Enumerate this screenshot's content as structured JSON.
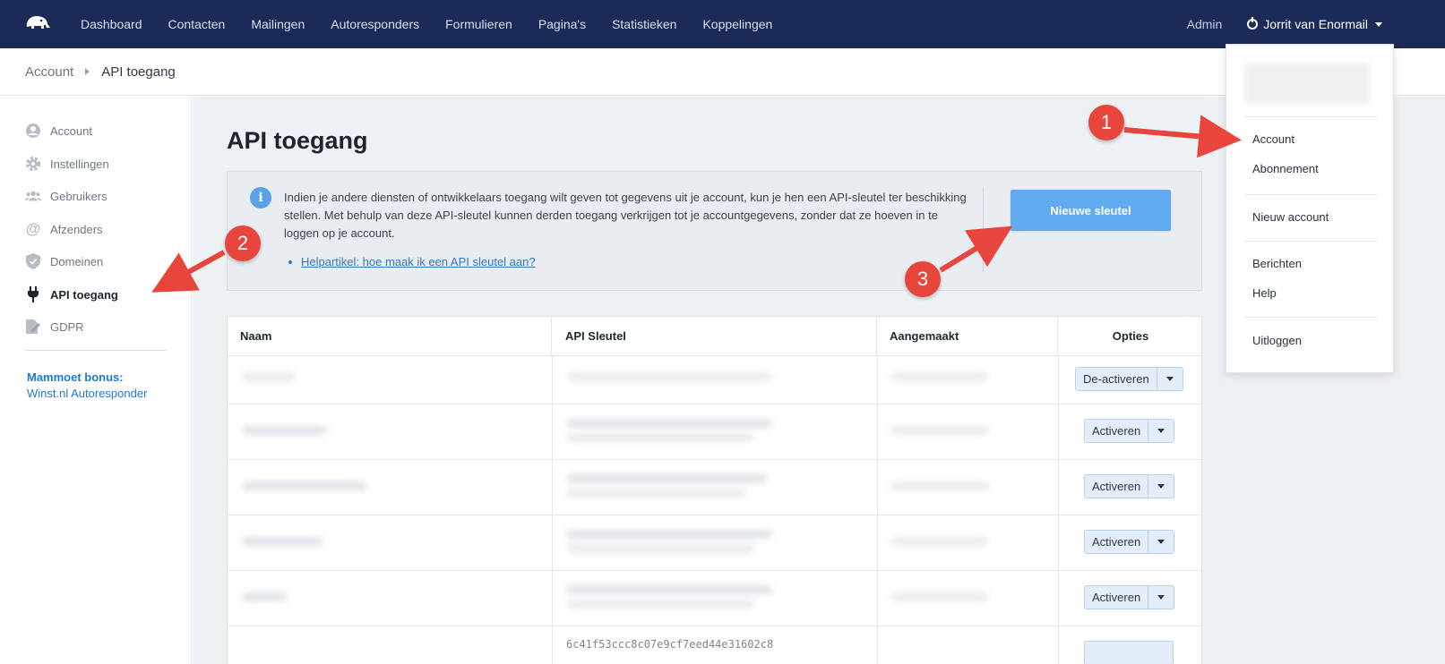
{
  "topnav": {
    "items": [
      "Dashboard",
      "Contacten",
      "Mailingen",
      "Autoresponders",
      "Formulieren",
      "Pagina's",
      "Statistieken",
      "Koppelingen"
    ],
    "admin": "Admin",
    "user": "Jorrit van Enormail"
  },
  "breadcrumb": {
    "parent": "Account",
    "current": "API toegang"
  },
  "sidebar": {
    "items": [
      "Account",
      "Instellingen",
      "Gebruikers",
      "Afzenders",
      "Domeinen",
      "API toegang",
      "GDPR"
    ],
    "bonus_title": "Mammoet bonus:",
    "bonus_link": "Winst.nl Autoresponder"
  },
  "main": {
    "title": "API toegang",
    "info_text": "Indien je andere diensten of ontwikkelaars toegang wilt geven tot gegevens uit je account, kun je hen een API-sleutel ter beschikking stellen. Met behulp van deze API-sleutel kunnen derden toegang verkrijgen tot je accountgegevens, zonder dat ze hoeven in te loggen op je account.",
    "help_link": "Helpartikel: hoe maak ik een API sleutel aan?",
    "new_key_button": "Nieuwe sleutel"
  },
  "table": {
    "headers": [
      "Naam",
      "API Sleutel",
      "Aangemaakt",
      "Opties"
    ],
    "rows": [
      {
        "option": "De-activeren"
      },
      {
        "option": "Activeren"
      },
      {
        "option": "Activeren"
      },
      {
        "option": "Activeren"
      },
      {
        "option": "Activeren"
      }
    ],
    "partial_key": "6c41f53ccc8c07e9cf7eed44e31602c8"
  },
  "dropdown": {
    "group1": [
      "Account",
      "Abonnement"
    ],
    "group2": [
      "Nieuw account"
    ],
    "group3": [
      "Berichten",
      "Help"
    ],
    "group4": [
      "Uitloggen"
    ]
  },
  "annotations": [
    "1",
    "2",
    "3"
  ],
  "colors": {
    "topbar": "#1b2a57",
    "accent_button": "#62abf0",
    "link": "#1f7ad1",
    "annotation": "#e8453c"
  }
}
